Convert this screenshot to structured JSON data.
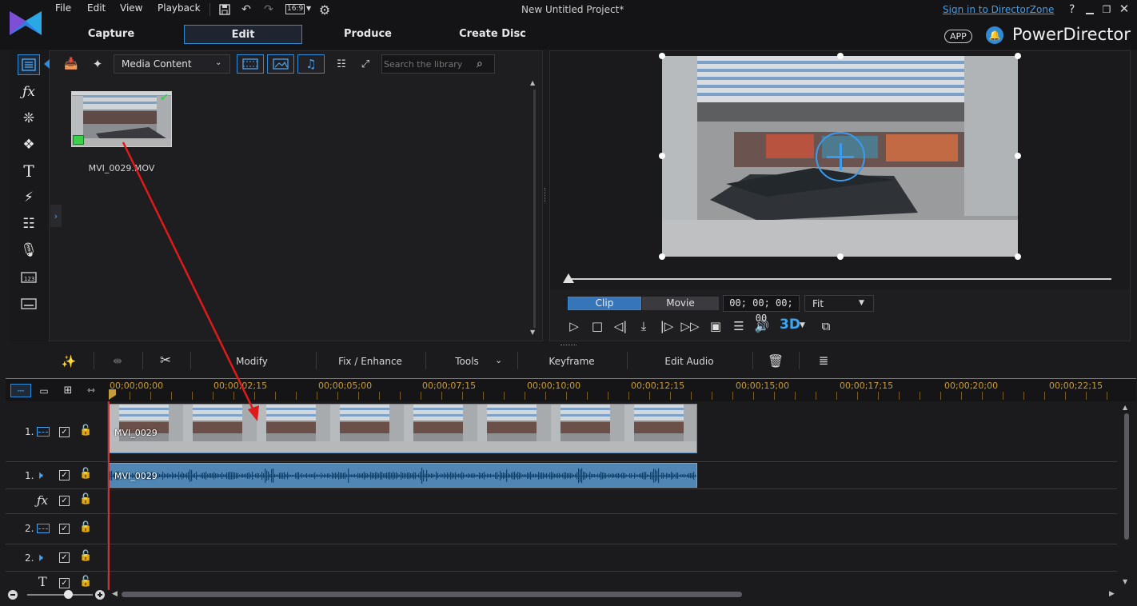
{
  "menu": {
    "items": [
      "File",
      "Edit",
      "View",
      "Playback"
    ],
    "aspect_ratio": "16:9",
    "project_title": "New Untitled Project*",
    "sign_in_link": "Sign in to DirectorZone",
    "help": "?",
    "app_badge": "APP",
    "app_name": "PowerDirector"
  },
  "mode_tabs": [
    "Capture",
    "Edit",
    "Produce",
    "Create Disc"
  ],
  "library": {
    "filter_select": "Media Content",
    "search_placeholder": "Search the library",
    "items": [
      {
        "label": "MVI_0029.MOV"
      }
    ]
  },
  "preview": {
    "mode_clip": "Clip",
    "mode_movie": "Movie",
    "timecode": "00; 00; 00; 00",
    "zoom_select": "Fit",
    "btn_3d": "3D"
  },
  "edit_toolbar": {
    "modify": "Modify",
    "fix_enhance": "Fix / Enhance",
    "tools": "Tools",
    "keyframe": "Keyframe",
    "edit_audio": "Edit Audio"
  },
  "timeline": {
    "ruler": [
      "00;00;00;00",
      "00;00;02;15",
      "00;00;05;00",
      "00;00;07;15",
      "00;00;10;00",
      "00;00;12;15",
      "00;00;15;00",
      "00;00;17;15",
      "00;00;20;00",
      "00;00;22;15"
    ],
    "tracks": [
      {
        "number": "1.",
        "kind": "video"
      },
      {
        "number": "1.",
        "kind": "audio"
      },
      {
        "number": "",
        "kind": "fx"
      },
      {
        "number": "2.",
        "kind": "video"
      },
      {
        "number": "2.",
        "kind": "audio"
      },
      {
        "number": "",
        "kind": "title"
      }
    ],
    "video_clip_label": "MVI_0029",
    "audio_clip_label": "MVI_0029"
  },
  "colors": {
    "accent": "#2f8bd8",
    "timeline_ruler": "#c89b3a",
    "playhead": "#d23030",
    "audio_clip": "#4f86b3",
    "drag_arrow": "#e01919"
  }
}
